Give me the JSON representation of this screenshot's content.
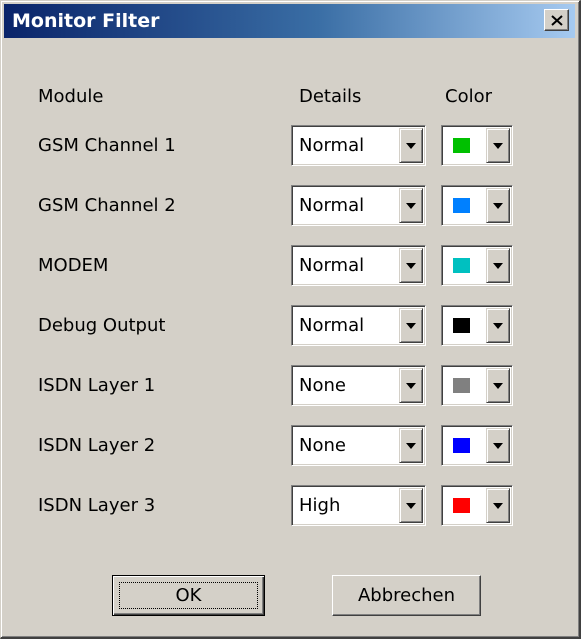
{
  "window": {
    "title": "Monitor Filter",
    "close_glyph": "×"
  },
  "headers": {
    "module": "Module",
    "details": "Details",
    "color": "Color"
  },
  "rows": [
    {
      "module": "GSM Channel 1",
      "details": "Normal",
      "color": "#00c000"
    },
    {
      "module": "GSM Channel 2",
      "details": "Normal",
      "color": "#0080ff"
    },
    {
      "module": "MODEM",
      "details": "Normal",
      "color": "#00c0c0"
    },
    {
      "module": "Debug Output",
      "details": "Normal",
      "color": "#000000"
    },
    {
      "module": "ISDN Layer 1",
      "details": "None",
      "color": "#808080"
    },
    {
      "module": "ISDN Layer 2",
      "details": "None",
      "color": "#0000ff"
    },
    {
      "module": "ISDN Layer 3",
      "details": "High",
      "color": "#ff0000"
    }
  ],
  "buttons": {
    "ok": "OK",
    "cancel": "Abbrechen"
  },
  "icons": {
    "close": "close-icon",
    "dropdown": "chevron-down-icon"
  },
  "theme": {
    "face": "#d4d0c8",
    "title_start": "#0a246a",
    "title_end": "#a6caf0"
  }
}
